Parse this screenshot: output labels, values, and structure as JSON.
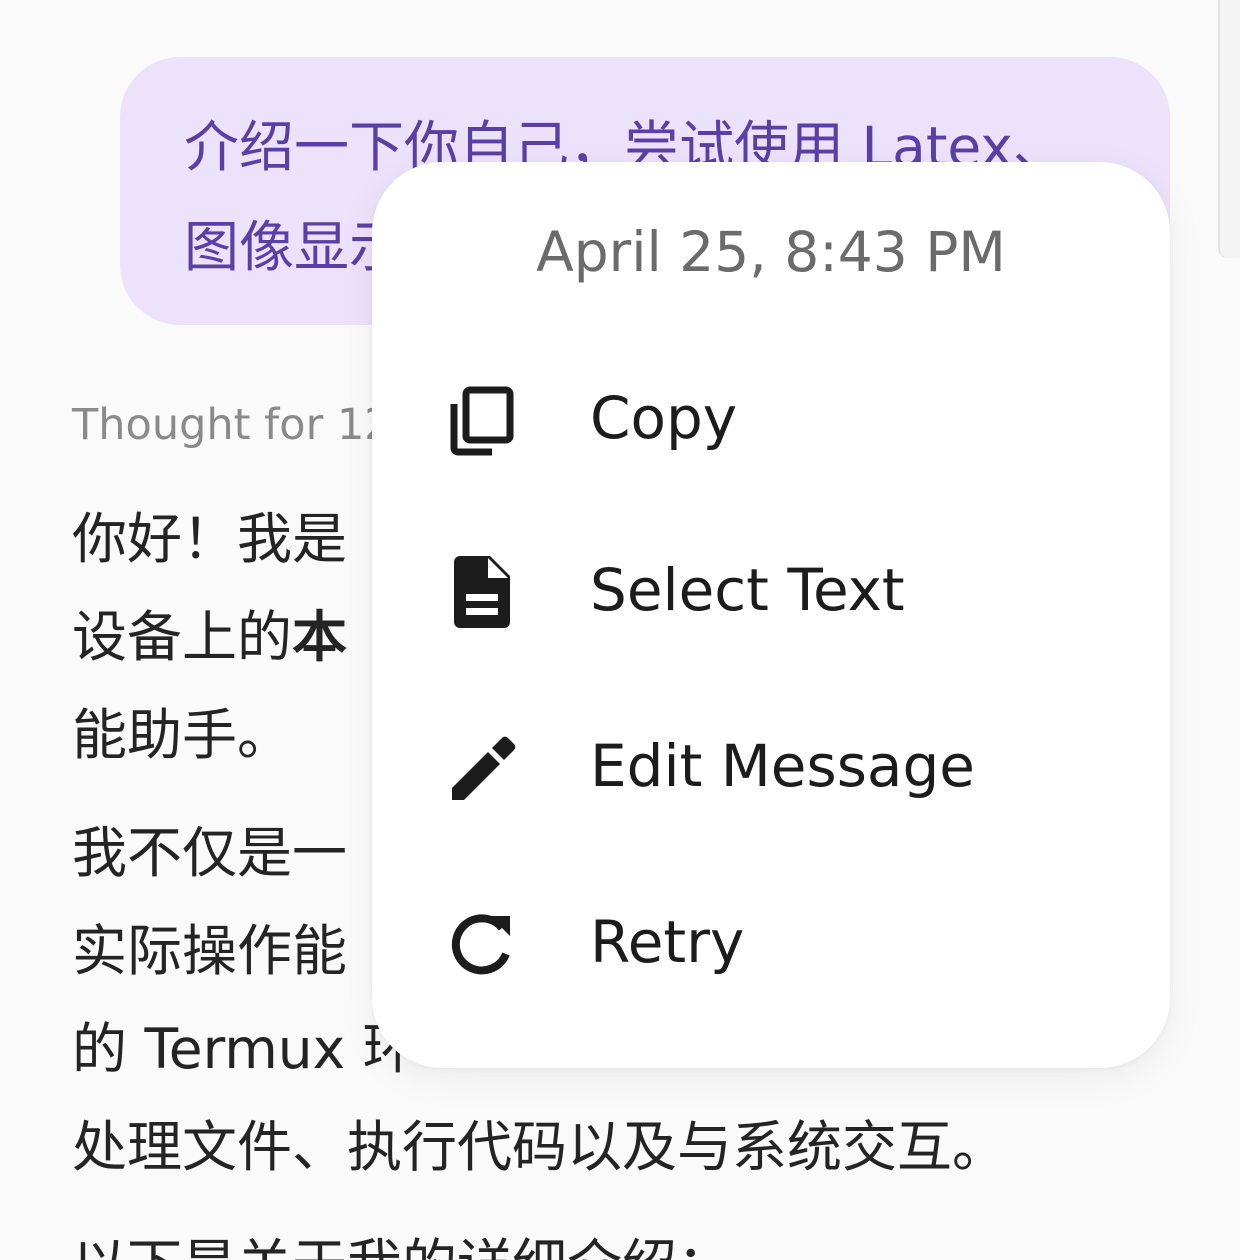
{
  "chat": {
    "user_message": {
      "line1": "介绍一下你自己，尝试使用 Latex、",
      "line2": "图像显示"
    },
    "thought_label": "Thought for 12s",
    "assistant": {
      "p1_line1": "你好！我是",
      "p1_line2_a": "设备上的",
      "p1_line2_b": "本",
      "p1_line3": "能助手。",
      "p2_line1": "我不仅是一",
      "p2_line2": "实际操作能",
      "p2_line3": "的 Termux 环",
      "p2_line4": "处理文件、执行代码以及与系统交互。",
      "p3_line1": "以下是关于我的详细介绍："
    }
  },
  "context_menu": {
    "timestamp": "April 25, 8:43 PM",
    "items": [
      {
        "label": "Copy",
        "icon": "copy-icon"
      },
      {
        "label": "Select Text",
        "icon": "document-icon"
      },
      {
        "label": "Edit Message",
        "icon": "pencil-icon"
      },
      {
        "label": "Retry",
        "icon": "refresh-icon"
      }
    ]
  },
  "colors": {
    "user_bubble_bg": "#ede2fb",
    "user_bubble_text": "#5a40a6",
    "menu_bg": "#ffffff",
    "menu_text": "#1c1c1c",
    "timestamp_text": "#6b6b6b"
  }
}
